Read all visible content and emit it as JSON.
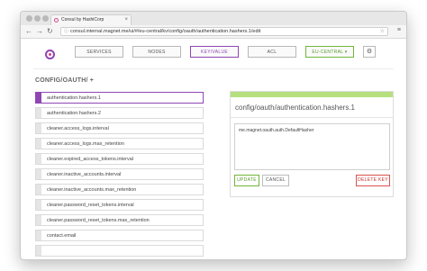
{
  "browser": {
    "tab_title": "Consul by HashiCorp",
    "url": "consul.internal.magnet.me/ui/#/eu-central/kv/config/oauth/authentication.hashers.1/edit"
  },
  "nav": {
    "services": "SERVICES",
    "nodes": "NODES",
    "keyvalue": "KEY/VALUE",
    "acl": "ACL",
    "datacenter": "EU-CENTRAL ▾"
  },
  "breadcrumb": "CONFIG/OAUTH/ +",
  "keys": [
    "authentication.hashers.1",
    "authentication.hashers.2",
    "cleaner.access_logs.interval",
    "cleaner.access_logs.max_retention",
    "cleaner.expired_access_tokens.interval",
    "cleaner.inactive_accounts.interval",
    "cleaner.inactive_accounts.max_retention",
    "cleaner.password_reset_tokens.interval",
    "cleaner.password_reset_tokens.max_retention",
    "contact.email"
  ],
  "detail": {
    "title": "config/oauth/authentication.hashers.1",
    "value": "me.magnet.oauth.auth.DefaultHasher",
    "update": "UPDATE",
    "cancel": "CANCEL",
    "delete": "DELETE KEY"
  },
  "colors": {
    "accent": "#8f46b3",
    "success": "#72b63a",
    "danger": "#d9534f"
  }
}
